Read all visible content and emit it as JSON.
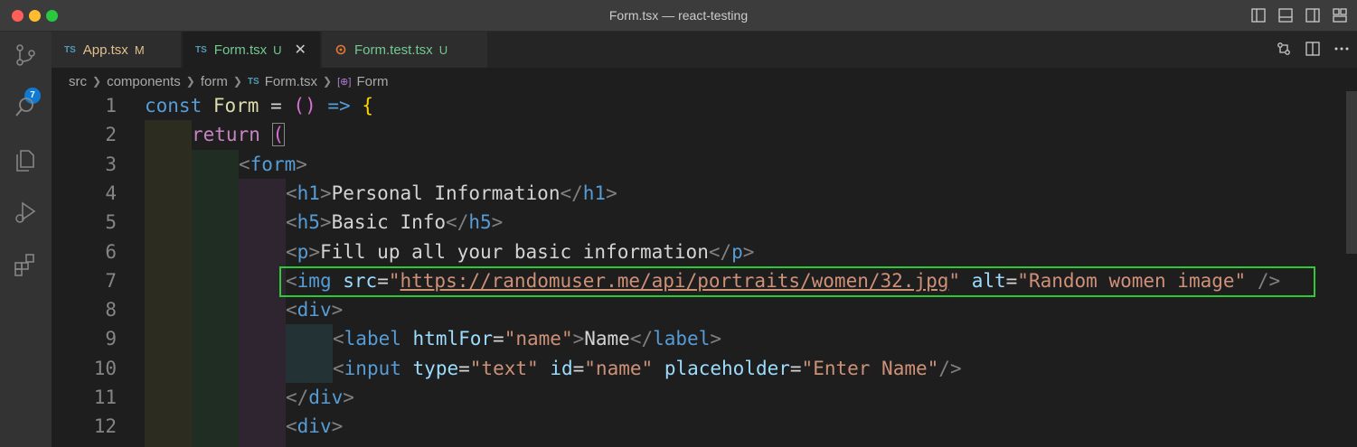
{
  "window": {
    "title": "Form.tsx — react-testing"
  },
  "activity_bar": {
    "items": [
      {
        "icon": "source-control-icon",
        "badge": "7"
      },
      {
        "icon": "search-icon"
      },
      {
        "icon": "explorer-icon"
      },
      {
        "icon": "run-debug-icon"
      },
      {
        "icon": "extensions-icon"
      }
    ]
  },
  "tabs": [
    {
      "lang": "TS",
      "label": "App.tsx",
      "status": "M",
      "active": false
    },
    {
      "lang": "TS",
      "label": "Form.tsx",
      "status": "U",
      "active": true
    },
    {
      "lang": "test",
      "label": "Form.test.tsx",
      "status": "U",
      "active": false
    }
  ],
  "breadcrumb": {
    "parts": [
      "src",
      "components",
      "form"
    ],
    "file_lang": "TS",
    "file": "Form.tsx",
    "symbol": "Form"
  },
  "editor": {
    "line_numbers": [
      "1",
      "2",
      "3",
      "4",
      "5",
      "6",
      "7",
      "8",
      "9",
      "10",
      "11",
      "12"
    ],
    "lines": {
      "l1": {
        "kw": "const",
        "name": "Form",
        "eq": "=",
        "paren": "()",
        "arrow": "=>",
        "brace": "{"
      },
      "l2": {
        "kw": "return",
        "paren": "("
      },
      "l3": {
        "tag": "form"
      },
      "l4": {
        "tag": "h1",
        "text": "Personal Information"
      },
      "l5": {
        "tag": "h5",
        "text": "Basic Info"
      },
      "l6": {
        "tag": "p",
        "text": "Fill up all your basic information"
      },
      "l7": {
        "tag": "img",
        "attr1": "src",
        "val1": "https://randomuser.me/api/portraits/women/32.jpg",
        "attr2": "alt",
        "val2": "Random women image"
      },
      "l8": {
        "tag": "div"
      },
      "l9": {
        "tag": "label",
        "attr": "htmlFor",
        "val": "name",
        "text": "Name"
      },
      "l10": {
        "tag": "input",
        "attr1": "type",
        "val1": "text",
        "attr2": "id",
        "val2": "name",
        "attr3": "placeholder",
        "val3": "Enter Name"
      },
      "l11": {
        "tag": "div"
      },
      "l12": {
        "tag": "div"
      }
    }
  },
  "colors": {
    "highlight_border": "#2dc937",
    "badge": "#0e7ad3"
  }
}
